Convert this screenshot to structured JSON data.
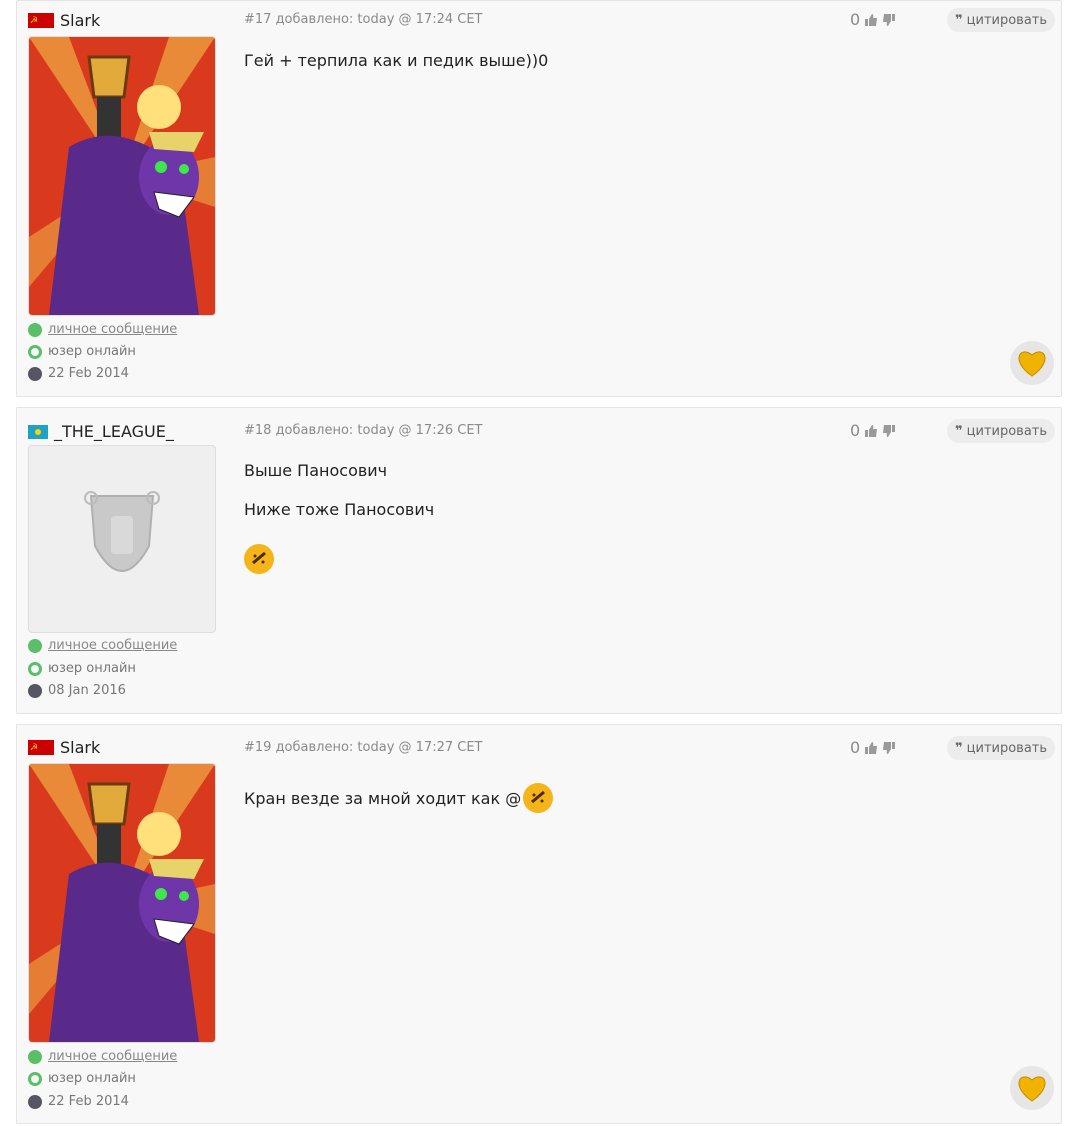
{
  "posts": [
    {
      "author": "Slark",
      "meta": "#17 добавлено: today @ 17:24 CET",
      "votes": "0",
      "quote_label": "цитировать",
      "lines": [
        "Гей + терпила как и педик выше))0"
      ],
      "pm_label": "личное сообщение",
      "online_label": "юзер онлайн",
      "joined": "22 Feb 2014"
    },
    {
      "author": "_THE_LEAGUE_",
      "meta": "#18 добавлено: today @ 17:26 CET",
      "votes": "0",
      "quote_label": "цитировать",
      "lines": [
        "Выше Паносович",
        "Ниже тоже Паносович"
      ],
      "pm_label": "личное сообщение",
      "online_label": "юзер онлайн",
      "joined": "08 Jan 2016"
    },
    {
      "author": "Slark",
      "meta": "#19 добавлено: today @ 17:27 CET",
      "votes": "0",
      "quote_label": "цитировать",
      "lines": [
        "Кран везде за мной ходит как @"
      ],
      "pm_label": "личное сообщение",
      "online_label": "юзер онлайн",
      "joined": "22 Feb 2014"
    }
  ]
}
